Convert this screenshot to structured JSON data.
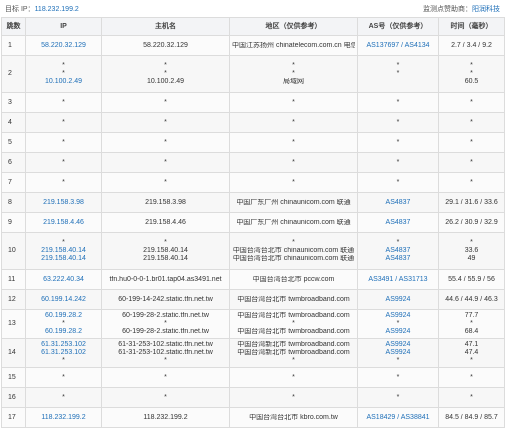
{
  "topbar": {
    "target_label": "目标 IP：",
    "target_ip": "118.232.199.2",
    "monitor_label": "监测点赞助商：",
    "monitor_vendor": "阳润科技"
  },
  "table": {
    "headers": [
      "跳数",
      "IP",
      "主机名",
      "地区（仅供参考）",
      "AS号（仅供参考）",
      "时间（毫秒）"
    ],
    "rows": [
      {
        "hop": "1",
        "ip": [
          "58.220.32.129"
        ],
        "host": [
          "58.220.32.129"
        ],
        "region": [
          "中国江苏扬州 chinatelecom.com.cn 电信"
        ],
        "as": [
          "AS137697 / AS4134"
        ],
        "time": [
          "2.7 / 3.4 / 9.2"
        ]
      },
      {
        "hop": "2",
        "ip": [
          "*",
          "*",
          "10.100.2.49"
        ],
        "host": [
          "*",
          "*",
          "10.100.2.49"
        ],
        "region": [
          "*",
          "*",
          "局域网"
        ],
        "as": [
          "*",
          "*",
          ""
        ],
        "time": [
          "*",
          "*",
          "60.5"
        ]
      },
      {
        "hop": "3",
        "ip": [
          "*"
        ],
        "host": [
          "*"
        ],
        "region": [
          "*"
        ],
        "as": [
          "*"
        ],
        "time": [
          "*"
        ]
      },
      {
        "hop": "4",
        "ip": [
          "*"
        ],
        "host": [
          "*"
        ],
        "region": [
          "*"
        ],
        "as": [
          "*"
        ],
        "time": [
          "*"
        ]
      },
      {
        "hop": "5",
        "ip": [
          "*"
        ],
        "host": [
          "*"
        ],
        "region": [
          "*"
        ],
        "as": [
          "*"
        ],
        "time": [
          "*"
        ]
      },
      {
        "hop": "6",
        "ip": [
          "*"
        ],
        "host": [
          "*"
        ],
        "region": [
          "*"
        ],
        "as": [
          "*"
        ],
        "time": [
          "*"
        ]
      },
      {
        "hop": "7",
        "ip": [
          "*"
        ],
        "host": [
          "*"
        ],
        "region": [
          "*"
        ],
        "as": [
          "*"
        ],
        "time": [
          "*"
        ]
      },
      {
        "hop": "8",
        "ip": [
          "219.158.3.98"
        ],
        "host": [
          "219.158.3.98"
        ],
        "region": [
          "中国广东广州 chinaunicom.com 联通"
        ],
        "as": [
          "AS4837"
        ],
        "time": [
          "29.1 / 31.6 / 33.6"
        ]
      },
      {
        "hop": "9",
        "ip": [
          "219.158.4.46"
        ],
        "host": [
          "219.158.4.46"
        ],
        "region": [
          "中国广东广州 chinaunicom.com 联通"
        ],
        "as": [
          "AS4837"
        ],
        "time": [
          "26.2 / 30.9 / 32.9"
        ]
      },
      {
        "hop": "10",
        "ip": [
          "*",
          "219.158.40.14",
          "219.158.40.14"
        ],
        "host": [
          "*",
          "219.158.40.14",
          "219.158.40.14"
        ],
        "region": [
          "*",
          "中国台湾台北市 chinaunicom.com 联通",
          "中国台湾台北市 chinaunicom.com 联通"
        ],
        "as": [
          "*",
          "AS4837",
          "AS4837"
        ],
        "time": [
          "*",
          "33.6",
          "49"
        ]
      },
      {
        "hop": "11",
        "ip": [
          "63.222.40.34"
        ],
        "host": [
          "tfn.hu0-0-0-1.br01.tap04.as3491.net"
        ],
        "region": [
          "中国台湾台北市 pccw.com"
        ],
        "as": [
          "AS3491 / AS31713"
        ],
        "time": [
          "55.4 / 55.9 / 56"
        ]
      },
      {
        "hop": "12",
        "ip": [
          "60.199.14.242"
        ],
        "host": [
          "60-199-14-242.static.tfn.net.tw"
        ],
        "region": [
          "中国台湾台北市 twmbroadband.com"
        ],
        "as": [
          "AS9924"
        ],
        "time": [
          "44.6 / 44.9 / 46.3"
        ]
      },
      {
        "hop": "13",
        "ip": [
          "60.199.28.2",
          "*",
          "60.199.28.2"
        ],
        "host": [
          "60-199-28-2.static.tfn.net.tw",
          "*",
          "60-199-28-2.static.tfn.net.tw"
        ],
        "region": [
          "中国台湾台北市 twmbroadband.com",
          "*",
          "中国台湾台北市 twmbroadband.com"
        ],
        "as": [
          "AS9924",
          "*",
          "AS9924"
        ],
        "time": [
          "77.7",
          "*",
          "68.4"
        ]
      },
      {
        "hop": "14",
        "ip": [
          "61.31.253.102",
          "61.31.253.102",
          "*"
        ],
        "host": [
          "61-31-253-102.static.tfn.net.tw",
          "61-31-253-102.static.tfn.net.tw",
          "*"
        ],
        "region": [
          "中国台湾新北市 twmbroadband.com",
          "中国台湾新北市 twmbroadband.com",
          "*"
        ],
        "as": [
          "AS9924",
          "AS9924",
          "*"
        ],
        "time": [
          "47.1",
          "47.4",
          "*"
        ]
      },
      {
        "hop": "15",
        "ip": [
          "*"
        ],
        "host": [
          "*"
        ],
        "region": [
          "*"
        ],
        "as": [
          "*"
        ],
        "time": [
          "*"
        ]
      },
      {
        "hop": "16",
        "ip": [
          "*"
        ],
        "host": [
          "*"
        ],
        "region": [
          "*"
        ],
        "as": [
          "*"
        ],
        "time": [
          "*"
        ]
      },
      {
        "hop": "17",
        "ip": [
          "118.232.199.2"
        ],
        "host": [
          "118.232.199.2"
        ],
        "region": [
          "中国台湾台北市 kbro.com.tw"
        ],
        "as": [
          "AS18429 / AS38841"
        ],
        "time": [
          "84.5 / 84.9 / 85.7"
        ]
      }
    ]
  }
}
